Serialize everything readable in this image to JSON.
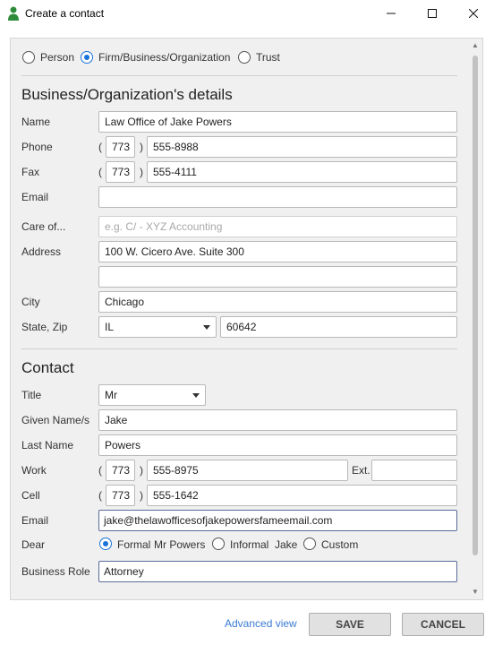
{
  "window": {
    "title": "Create a contact"
  },
  "entity_type": {
    "options": [
      {
        "label": "Person",
        "selected": false
      },
      {
        "label": "Firm/Business/Organization",
        "selected": true
      },
      {
        "label": "Trust",
        "selected": false
      }
    ]
  },
  "business": {
    "title": "Business/Organization's details",
    "name_label": "Name",
    "name_value": "Law Office of Jake Powers",
    "phone_label": "Phone",
    "phone_area": "773",
    "phone_number": "555-8988",
    "fax_label": "Fax",
    "fax_area": "773",
    "fax_number": "555-4111",
    "email_label": "Email",
    "email_value": "",
    "care_label": "Care of...",
    "care_placeholder": "e.g. C/ - XYZ Accounting",
    "address_label": "Address",
    "address_line1": "100 W. Cicero Ave. Suite 300",
    "address_line2": "",
    "city_label": "City",
    "city_value": "Chicago",
    "state_zip_label": "State, Zip",
    "state_value": "IL",
    "zip_value": "60642"
  },
  "contact": {
    "title": "Contact",
    "title_label": "Title",
    "title_value": "Mr",
    "given_label": "Given Name/s",
    "given_value": "Jake",
    "last_label": "Last Name",
    "last_value": "Powers",
    "work_label": "Work",
    "work_area": "773",
    "work_number": "555-8975",
    "ext_label": "Ext.",
    "ext_value": "",
    "cell_label": "Cell",
    "cell_area": "773",
    "cell_number": "555-1642",
    "email_label": "Email",
    "email_value": "jake@thelawofficesofjakepowersfameemail.com",
    "dear_label": "Dear",
    "dear_options": [
      {
        "label": "Formal",
        "detail": "Mr Powers",
        "selected": true
      },
      {
        "label": "Informal",
        "detail": "Jake",
        "selected": false
      },
      {
        "label": "Custom",
        "detail": "",
        "selected": false
      }
    ],
    "role_label": "Business Role",
    "role_value": "Attorney"
  },
  "paren_open": "(",
  "paren_close": ")",
  "footer": {
    "advanced_link": "Advanced view",
    "save_label": "SAVE",
    "cancel_label": "CANCEL"
  },
  "colors": {
    "accent": "#1a73d9",
    "link": "#3a7bd5",
    "panel_bg": "#f0f0f0"
  }
}
